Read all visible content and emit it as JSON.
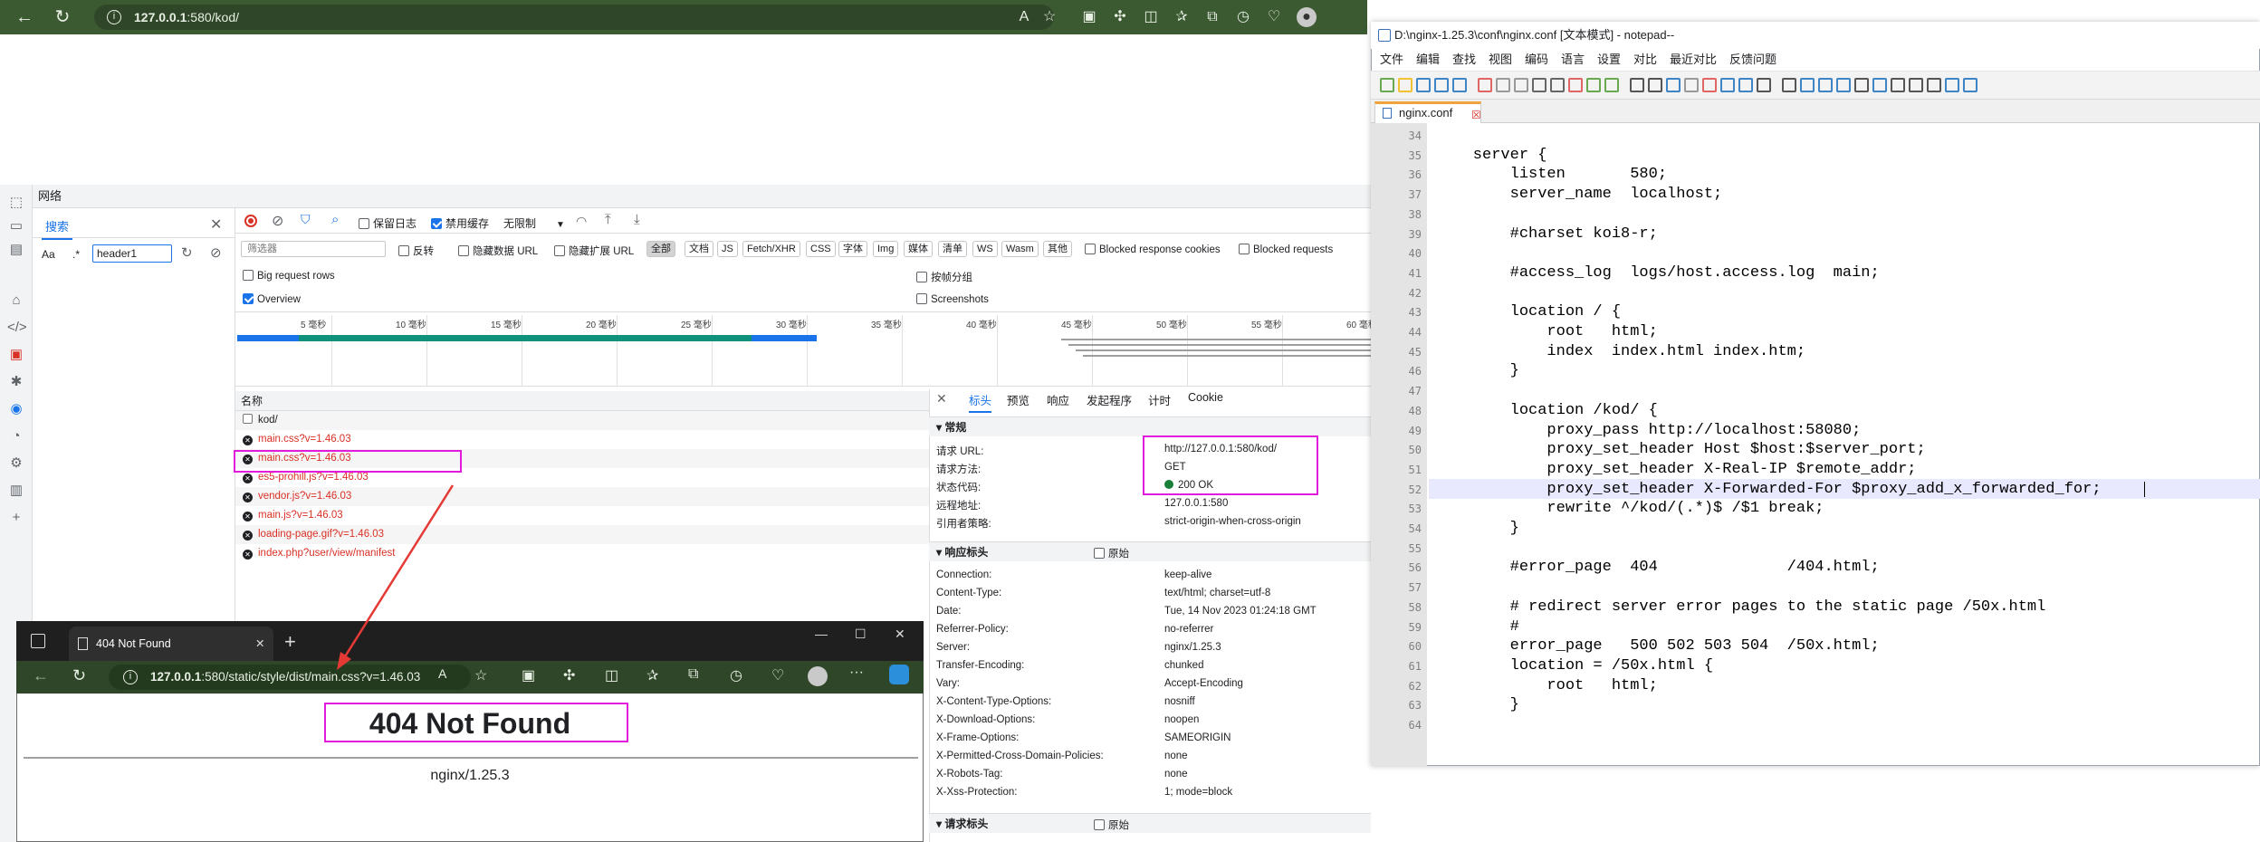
{
  "browser": {
    "url_host": "127.0.0.1",
    "url_rest": ":580/kod/"
  },
  "devtools": {
    "panel_title": "网络",
    "search": {
      "tab_label": "搜索",
      "aa_label": "Aa",
      "regex_label": ".*",
      "query": "header1"
    },
    "toolbar": {
      "preserve_log": "保留日志",
      "disable_cache": "禁用缓存",
      "throttle": "无限制"
    },
    "filter": {
      "placeholder": "筛选器",
      "invert": "反转",
      "hide_data_url": "隐藏数据 URL",
      "hide_ext_url": "隐藏扩展 URL",
      "types": [
        "全部",
        "文档",
        "JS",
        "Fetch/XHR",
        "CSS",
        "字体",
        "Img",
        "媒体",
        "清单",
        "WS",
        "Wasm",
        "其他"
      ],
      "blocked_cookies": "Blocked response cookies",
      "blocked_requests": "Blocked requests"
    },
    "options": {
      "big_rows": "Big request rows",
      "group_by_frame": "按帧分组",
      "overview": "Overview",
      "screenshots": "Screenshots"
    },
    "timeline_ticks": [
      "5 毫秒",
      "10 毫秒",
      "15 毫秒",
      "20 毫秒",
      "25 毫秒",
      "30 毫秒",
      "35 毫秒",
      "40 毫秒",
      "45 毫秒",
      "50 毫秒",
      "55 毫秒",
      "60 毫秒"
    ],
    "list_header": "名称",
    "requests": [
      {
        "name": "kod/",
        "error": false
      },
      {
        "name": "main.css?v=1.46.03",
        "error": true
      },
      {
        "name": "main.css?v=1.46.03",
        "error": true
      },
      {
        "name": "es5-prohill.js?v=1.46.03",
        "error": true
      },
      {
        "name": "vendor.js?v=1.46.03",
        "error": true
      },
      {
        "name": "main.js?v=1.46.03",
        "error": true
      },
      {
        "name": "loading-page.gif?v=1.46.03",
        "error": true
      },
      {
        "name": "index.php?user/view/manifest",
        "error": true
      }
    ],
    "detail_tabs": [
      "标头",
      "预览",
      "响应",
      "发起程序",
      "计时",
      "Cookie"
    ],
    "general": {
      "title": "常规",
      "rows": [
        {
          "k": "请求 URL:",
          "v": "http://127.0.0.1:580/kod/"
        },
        {
          "k": "请求方法:",
          "v": "GET"
        },
        {
          "k": "状态代码:",
          "v": "200 OK"
        },
        {
          "k": "远程地址:",
          "v": "127.0.0.1:580"
        },
        {
          "k": "引用者策略:",
          "v": "strict-origin-when-cross-origin"
        }
      ]
    },
    "response_headers": {
      "title": "响应标头",
      "raw_label": "原始",
      "rows": [
        {
          "k": "Connection:",
          "v": "keep-alive"
        },
        {
          "k": "Content-Type:",
          "v": "text/html; charset=utf-8"
        },
        {
          "k": "Date:",
          "v": "Tue, 14 Nov 2023 01:24:18 GMT"
        },
        {
          "k": "Referrer-Policy:",
          "v": "no-referrer"
        },
        {
          "k": "Server:",
          "v": "nginx/1.25.3"
        },
        {
          "k": "Transfer-Encoding:",
          "v": "chunked"
        },
        {
          "k": "Vary:",
          "v": "Accept-Encoding"
        },
        {
          "k": "X-Content-Type-Options:",
          "v": "nosniff"
        },
        {
          "k": "X-Download-Options:",
          "v": "noopen"
        },
        {
          "k": "X-Frame-Options:",
          "v": "SAMEORIGIN"
        },
        {
          "k": "X-Permitted-Cross-Domain-Policies:",
          "v": "none"
        },
        {
          "k": "X-Robots-Tag:",
          "v": "none"
        },
        {
          "k": "X-Xss-Protection:",
          "v": "1; mode=block"
        }
      ]
    },
    "request_headers": {
      "title": "请求标头",
      "raw_label": "原始"
    }
  },
  "notepad": {
    "title": "D:\\nginx-1.25.3\\conf\\nginx.conf [文本模式] - notepad--",
    "menu": [
      "文件",
      "编辑",
      "查找",
      "视图",
      "编码",
      "语言",
      "设置",
      "对比",
      "最近对比",
      "反馈问题"
    ],
    "tab": "nginx.conf",
    "lines": [
      {
        "n": "34",
        "t": ""
      },
      {
        "n": "35",
        "t": "    server {"
      },
      {
        "n": "36",
        "t": "        listen       580;"
      },
      {
        "n": "37",
        "t": "        server_name  localhost;"
      },
      {
        "n": "38",
        "t": ""
      },
      {
        "n": "39",
        "t": "        #charset koi8-r;"
      },
      {
        "n": "40",
        "t": ""
      },
      {
        "n": "41",
        "t": "        #access_log  logs/host.access.log  main;"
      },
      {
        "n": "42",
        "t": ""
      },
      {
        "n": "43",
        "t": "        location / {"
      },
      {
        "n": "44",
        "t": "            root   html;"
      },
      {
        "n": "45",
        "t": "            index  index.html index.htm;"
      },
      {
        "n": "46",
        "t": "        }"
      },
      {
        "n": "47",
        "t": ""
      },
      {
        "n": "48",
        "t": "        location /kod/ {"
      },
      {
        "n": "49",
        "t": "            proxy_pass http://localhost:58080;"
      },
      {
        "n": "50",
        "t": "            proxy_set_header Host $host:$server_port;"
      },
      {
        "n": "51",
        "t": "            proxy_set_header X-Real-IP $remote_addr;"
      },
      {
        "n": "52",
        "t": "            proxy_set_header X-Forwarded-For $proxy_add_x_forwarded_for;"
      },
      {
        "n": "53",
        "t": "            rewrite ^/kod/(.*)$ /$1 break;"
      },
      {
        "n": "54",
        "t": "        }"
      },
      {
        "n": "55",
        "t": ""
      },
      {
        "n": "56",
        "t": "        #error_page  404              /404.html;"
      },
      {
        "n": "57",
        "t": ""
      },
      {
        "n": "58",
        "t": "        # redirect server error pages to the static page /50x.html"
      },
      {
        "n": "59",
        "t": "        #"
      },
      {
        "n": "60",
        "t": "        error_page   500 502 503 504  /50x.html;"
      },
      {
        "n": "61",
        "t": "        location = /50x.html {"
      },
      {
        "n": "62",
        "t": "            root   html;"
      },
      {
        "n": "63",
        "t": "        }"
      },
      {
        "n": "64",
        "t": ""
      }
    ]
  },
  "win404": {
    "tab_title": "404 Not Found",
    "url_host": "127.0.0.1",
    "url_rest": ":580/static/style/dist/main.css?v=1.46.03",
    "heading": "404 Not Found",
    "footer": "nginx/1.25.3"
  },
  "colors": {
    "highlight": "#e21adb",
    "error_red": "#d93025",
    "browser_green": "#3c5a32"
  }
}
